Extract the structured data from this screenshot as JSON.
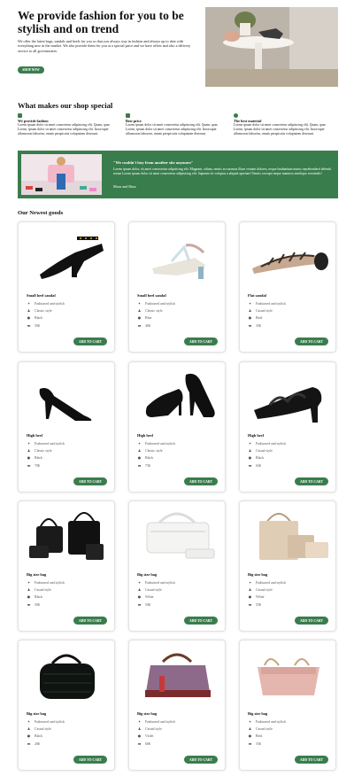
{
  "hero": {
    "title": "We provide fashion for you to be stylish and on trend",
    "text": "We offer the latest bags, sandals and heels for you so that you always stay in fashion and always up to date with everything new in the market. We also provide them for you at a special price and we have offers and also a delivery service to all governorates.",
    "button": "SHOP NOW"
  },
  "why": {
    "title": "What makes our shop special",
    "features": [
      {
        "icon": "shirt-icon",
        "name": "We provide fashion",
        "text": "Lorem ipsum dolor sit amet consectetur adipisicing elit. Quam, quas Lorem, ipsum dolor sit amet consectetur adipisicing elit. Incorrupte ullamcorm laborem, omnis perspicatis voluptatem deserunt."
      },
      {
        "icon": "price-icon",
        "name": "Best price",
        "text": "Lorem ipsum dolor sit amet consectetur adipisicing elit. Quam, quas Lorem, ipsum dolor sit amet consectetur adipisicing elit. Incorrupte ullamcorm laborem, omnis perspicatis voluptatem deserunt."
      },
      {
        "icon": "globe-icon",
        "name": "The best material",
        "text": "Lorem ipsum dolor sit amet consectetur adipisicing elit. Quam, quas Lorem, ipsum dolor sit amet consectetur adipisicing elit. Incorrupte ullamcorm laborem, omnis perspicatis voluptatem deserunt."
      }
    ]
  },
  "testimonial": {
    "quote": "\"We couldn't buy from another site anymore\"",
    "text": "Lorem ipsum dolor, sit amet consectetur adipisicing elit. Magnam, odium, omnis accusamus illum veniam dolores, neque laudantium minus reprehenderit deleniti rerum Lorem ipsum dolor sit amet consectetur adipisicing elit. Sapiente sit voluptas a aliquid aperiam! Omnis corrupti neque numeros similique reiciendis!",
    "author": "Mora and Dina."
  },
  "newest": {
    "title": "Our Newest goods",
    "cart_label": "ADD TO CART",
    "products": [
      {
        "name": "Small heel sandal",
        "feature": "Fashioned and stylish",
        "style": "Classic style",
        "color": "Black",
        "price": "50$",
        "art": "sandal-black"
      },
      {
        "name": "Small heel sandal",
        "feature": "Fashioned and stylish",
        "style": "Classic style",
        "color": "Blue",
        "price": "40$",
        "art": "sandal-strappy"
      },
      {
        "name": "Flat sandal",
        "feature": "Fashioned and stylish",
        "style": "Casual style",
        "color": "Beid",
        "price": "35$",
        "art": "sandal-flat"
      },
      {
        "name": "High heel",
        "feature": "Fashioned and stylish",
        "style": "Classic style",
        "color": "Black",
        "price": "70$",
        "art": "heel-single"
      },
      {
        "name": "High heel",
        "feature": "Fashioned and stylish",
        "style": "Classic style",
        "color": "Black",
        "price": "75$",
        "art": "heel-pair"
      },
      {
        "name": "High heel",
        "feature": "Fashioned and stylish",
        "style": "Casual style",
        "color": "Black",
        "price": "65$",
        "art": "heel-braided"
      },
      {
        "name": "Big size bag",
        "feature": "Fashioned and stylish",
        "style": "Casual style",
        "color": "Black",
        "price": "50$",
        "art": "bag-black-set"
      },
      {
        "name": "Big size bag",
        "feature": "Fashioned and stylish",
        "style": "Casual style",
        "color": "White",
        "price": "50$",
        "art": "bag-white"
      },
      {
        "name": "Big size bag",
        "feature": "Fashioned and stylish",
        "style": "Casual style",
        "color": "White",
        "price": "55$",
        "art": "bag-beige-set"
      },
      {
        "name": "Big size bag",
        "feature": "Fashioned and stylish",
        "style": "Casual style",
        "color": "Black",
        "price": "20$",
        "art": "bag-croc"
      },
      {
        "name": "Big size bag",
        "feature": "Fashioned and stylish",
        "style": "Casual style",
        "color": "Violet",
        "price": "60$",
        "art": "bag-violet"
      },
      {
        "name": "Big size bag",
        "feature": "Fashioned and stylish",
        "style": "Casual style",
        "color": "Beid",
        "price": "55$",
        "art": "bag-pink"
      }
    ]
  },
  "colors": {
    "accent": "#3a7d4d"
  }
}
